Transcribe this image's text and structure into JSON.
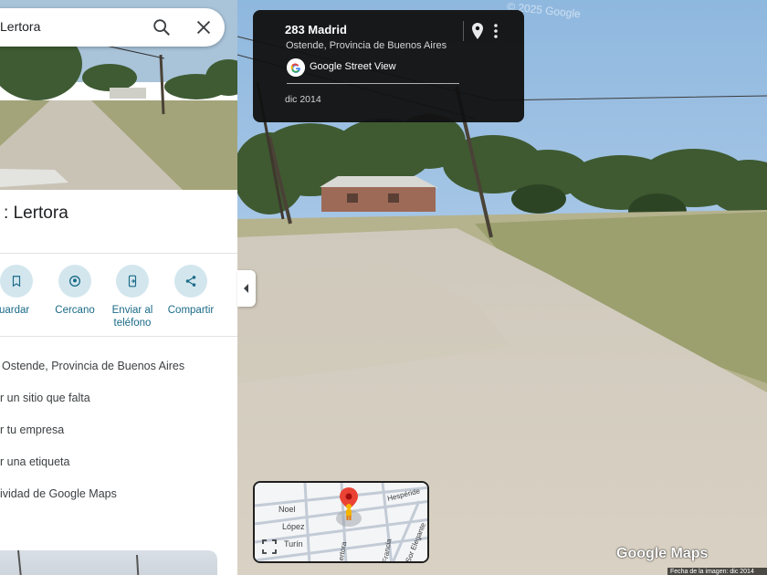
{
  "search": {
    "query": "Lertora"
  },
  "place": {
    "title": "Lertora"
  },
  "actions": [
    {
      "label": "Guardar",
      "icon": "bookmark-icon"
    },
    {
      "label": "Cercano",
      "icon": "nearby-icon"
    },
    {
      "label": "Enviar al teléfono",
      "icon": "phone-send-icon"
    },
    {
      "label": "Compartir",
      "icon": "share-icon"
    }
  ],
  "info_rows": [
    {
      "text": "Ostende, Provincia de Buenos Aires"
    },
    {
      "text": "r un sitio que falta"
    },
    {
      "text": "r tu empresa"
    },
    {
      "text": "r una etiqueta"
    },
    {
      "text": "ividad de Google Maps"
    }
  ],
  "street_view": {
    "address": "283 Madrid",
    "locality": "Ostende, Provincia de Buenos Aires",
    "provider": "Google Street View",
    "date": "dic 2014",
    "copyright": "© 2025 Google",
    "logo": "Google Maps",
    "image_date": "Fecha de la imagen: dic 2014"
  },
  "minimap": {
    "streets": [
      "Noel",
      "López",
      "Turín",
      "Lertora",
      "Francia",
      "Hespéride",
      "Sor Elegante"
    ]
  },
  "colors": {
    "accent": "#1a6a87",
    "action_bg": "#d3e6ee",
    "card_bg": "#121212",
    "pegman": "#f4b400",
    "marker": "#ea4335"
  }
}
